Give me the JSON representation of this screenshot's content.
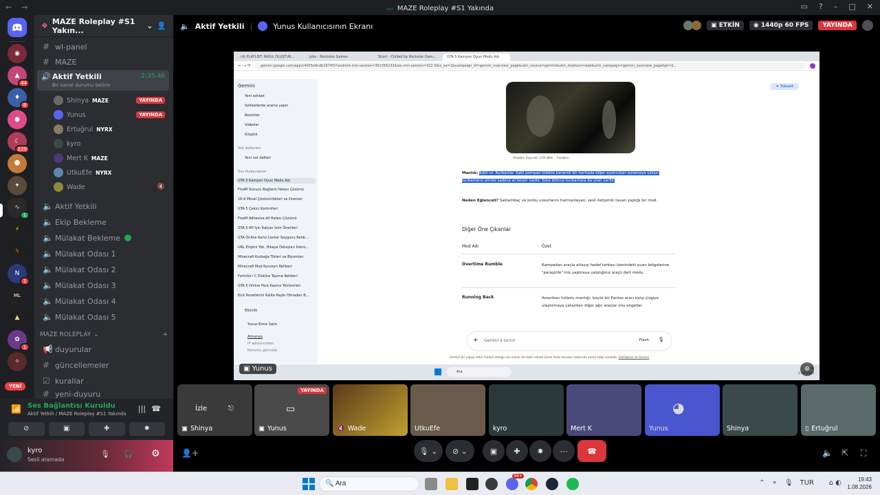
{
  "window": {
    "title": "MAZE Roleplay #S1 Yakında"
  },
  "servers": {
    "badges": [
      "44",
      "8",
      "220",
      "1",
      "1",
      "1"
    ],
    "new_label": "YENİ"
  },
  "guild": {
    "name": "MAZE Roleplay #S1 Yakın..."
  },
  "channels": {
    "top": [
      "wl-panel",
      "MAZE"
    ],
    "active_voice": {
      "name": "Aktif Yetkili",
      "timer": "2:35:46",
      "status_hint": "Bir kanal durumu belirle"
    },
    "voice_users": [
      {
        "name": "Shinya",
        "tag": "MAZE",
        "live": "YAYINDA"
      },
      {
        "name": "Yunus",
        "tag": "",
        "live": "YAYINDA"
      },
      {
        "name": "Ertuğrul",
        "tag": "NYRX",
        "live": ""
      },
      {
        "name": "kyro",
        "tag": "",
        "live": ""
      },
      {
        "name": "Mert K",
        "tag": "MAZE",
        "live": ""
      },
      {
        "name": "UtkuEfe",
        "tag": "NYRX",
        "live": ""
      },
      {
        "name": "Wade",
        "tag": "",
        "live": ""
      }
    ],
    "voice_channels": [
      "Aktif Yetkili",
      "Ekip Bekleme",
      "Mülakat Bekleme",
      "Mülakat Odası 1",
      "Mülakat Odası 2",
      "Mülakat Odası 3",
      "Mülakat Odası 4",
      "Mülakat Odası 5"
    ],
    "category": "MAZE ROLEPLAY",
    "text_channels": [
      "duyurular",
      "güncellemeler",
      "kurallar",
      "yeni-duyuru"
    ]
  },
  "voice_panel": {
    "status": "Ses Bağlantısı Kuruldu",
    "location": "Aktif Yetkili / MAZE Roleplay #S1 Yakında"
  },
  "user": {
    "name": "kyro",
    "status": "Sesli aramada"
  },
  "header": {
    "channel": "Aktif Yetkili",
    "screen": "Yunus Kullanıcısının Ekranı",
    "activity": "ETKİN",
    "quality": "1440p 60 FPS",
    "live": "YAYINDA"
  },
  "stream": {
    "owner": "Yunus",
    "browser_tabs": [
      "(4) PLAYLIST: NASIL OLUŞTUR...",
      "Jobs - Rockstar Games",
      "Stunt - Chilled by Rockstar Gam...",
      "GTA 5 Kamyon Oyun Modu Adı"
    ],
    "url": "gemini.google.com/app/c4005e9cdb1674f3?android-min-version=301356232&ios-min-version=322.0&is_sa=1&campaign_id=gemini_overview_page&utm_source=gemini&utm_medium=web&utm_campaign=gemini_overview_page&pt=9...",
    "sidebar": {
      "app": "Gemini",
      "items": [
        "Yeni sohbet",
        "Sohbetlerde arama yapın",
        "Resimler",
        "Videolar",
        "Kitaplık"
      ],
      "notes_label": "Not defterleri",
      "new_note": "Yeni not defteri",
      "recent_label": "Son Kullanılanlar",
      "recent": [
        "GTA 5 Kamyon Oyun Modu Adı",
        "FiveM Sunucu Bağlantı Hatası Çözümü",
        "16:9 Piksel Çözünürlükleri ve Oranları",
        "GTA 5 Çekici Kontrolleri",
        "FiveM Adhesive.dll Hatası Çözümü",
        "GTA 5 RP İçin İtalyan İsim Önerileri",
        "GTA Online Kortz Center Soygunu Rehb...",
        "URL Erişimi Yok, Hikaye Detayları İsteni...",
        "Minecraft Kurbağa Türleri ve Biyomları",
        "Minecraft Mod Kurulum Rehberi",
        "Fortnite'ı C Diskine Taşıma Rehberi",
        "GTA 5 Online Para Kasma Yöntemleri",
        "Kick Rozetlerini Kalite Kaybı Olmadan B..."
      ],
      "activity": "Etkinlik",
      "account": "Yunus Emre Saim",
      "loc_title": "Almanya",
      "loc_sub1": "IP adresinizden",
      "loc_sub2": "Konumu güncelle"
    },
    "content": {
      "upgrade": "Yükselt",
      "caption": "Slasher. Kaynak: GTA Wiki – Fandom",
      "bullet1_label": "Mantık:",
      "bullet1_text": "Katil vs. Kurbanlar. Katil pompalı tüfekle karanlık bir haritada diğer oyuncuları avlamaya çalışır; kurbanların elinde sadece el feneri vardır. Süre bitince kurbanlara da silah verilir.",
      "bullet2_label": "Neden Eğlenceli?",
      "bullet2_text": "Saklambaç ve korku unsurlarını harmanlayan, sesli iletişimin tavan yaptığı bir mod.",
      "section": "Diğer Öne Çıkanlar",
      "col1": "Mod Adı",
      "col2": "Özet",
      "rows": [
        {
          "name": "Overtime Rumble",
          "desc": "Rampadan araçla atlayıp hedef tahtası üzerindeki puan bölgelerine \"paraşütle\" iniş yapmaya çalıştığınız araçlı dart modu."
        },
        {
          "name": "Running Back",
          "desc": "Amerikan futbolu mantığı; küçük bir Pantos aracı karşı çizgiye ulaştırmaya çalışırken diğer ağır araçlar onu engeller."
        }
      ],
      "prompt_placeholder": "Gemini'a sorun",
      "model": "Flash",
      "disclaimer": "Gemini bir yapay zeka modeli olduğu için kişiler de dahil olmak üzere farklı konular hakkında yanlış bilgi verebilir.",
      "disclaimer_link": "Gizliliğiniz ve Gemini"
    },
    "inner_taskbar": {
      "search": "Ara",
      "time": "19:43",
      "date": "2.08.2026"
    }
  },
  "tiles": [
    {
      "name": "Shinya",
      "action": "İzle",
      "live": ""
    },
    {
      "name": "Yunus",
      "action": "",
      "live": "YAYINDA"
    },
    {
      "name": "Wade",
      "action": "",
      "live": ""
    },
    {
      "name": "UtkuEfe",
      "action": "",
      "live": ""
    },
    {
      "name": "kyro",
      "action": "",
      "live": ""
    },
    {
      "name": "Mert K",
      "action": "",
      "live": ""
    },
    {
      "name": "Yunus",
      "action": "",
      "live": ""
    },
    {
      "name": "Shinya",
      "action": "",
      "live": ""
    },
    {
      "name": "Ertuğrul",
      "action": "",
      "live": ""
    }
  ],
  "taskbar": {
    "search": "Ara",
    "lang": "TUR",
    "time": "19:43",
    "date": "1.08.2026",
    "discord_badge": "99+"
  },
  "colors": {
    "live_red": "#da373c",
    "connected_green": "#23a55a",
    "discord_blurple": "#5865f2"
  }
}
